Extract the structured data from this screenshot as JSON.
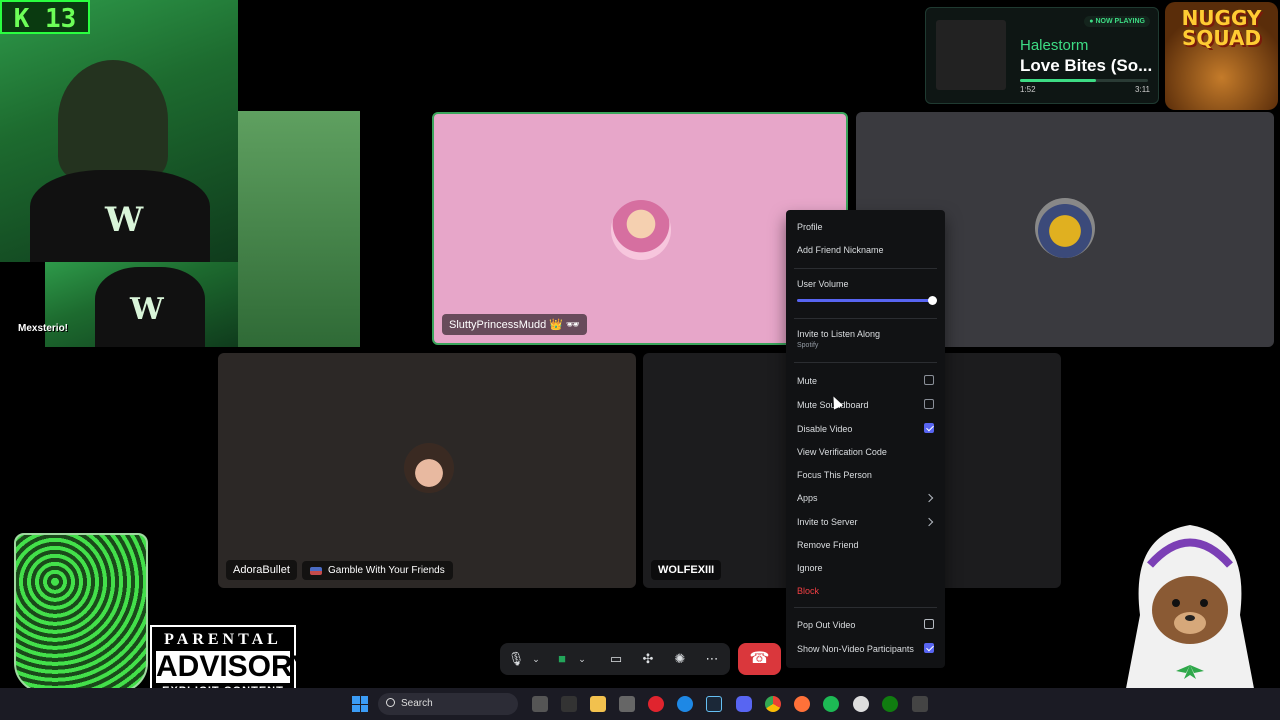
{
  "overlay": {
    "badge": "K 13",
    "streamer_name": "Mexsterio!",
    "now_playing": {
      "badge": "● NOW PLAYING",
      "artist": "Halestorm",
      "song": "Love Bites (So...",
      "elapsed": "1:52",
      "duration": "3:11",
      "progress": 0.59
    },
    "sponsor_logo": [
      "NUGGY",
      "SQUAD"
    ],
    "parental_advisory": {
      "line1": "PARENTAL",
      "line2": "ADVISORY",
      "line3": "EXPLICIT CONTENT"
    }
  },
  "tiles": [
    {
      "name": "SluttyPrincessMudd 👑 🕶"
    },
    {
      "name": "AdoraBullet",
      "activity": "Gamble With Your Friends"
    },
    {
      "name": "WOLFEXIII"
    }
  ],
  "context_menu": {
    "profile": "Profile",
    "add_nickname": "Add Friend Nickname",
    "user_volume": "User Volume",
    "volume_level": 1.0,
    "invite_listen": "Invite to Listen Along",
    "invite_listen_sub": "Spotify",
    "mute": "Mute",
    "mute_soundboard": "Mute Soundboard",
    "disable_video": "Disable Video",
    "view_verification": "View Verification Code",
    "focus_person": "Focus This Person",
    "apps": "Apps",
    "invite_server": "Invite to Server",
    "remove_friend": "Remove Friend",
    "ignore": "Ignore",
    "block": "Block",
    "pop_out": "Pop Out Video",
    "show_non_video": "Show Non-Video Participants"
  },
  "taskbar": {
    "search": "Search"
  },
  "colors": {
    "accent": "#5865f2",
    "speaking": "#3ba55c",
    "danger": "#da373c",
    "spotify": "#3ddc84"
  }
}
